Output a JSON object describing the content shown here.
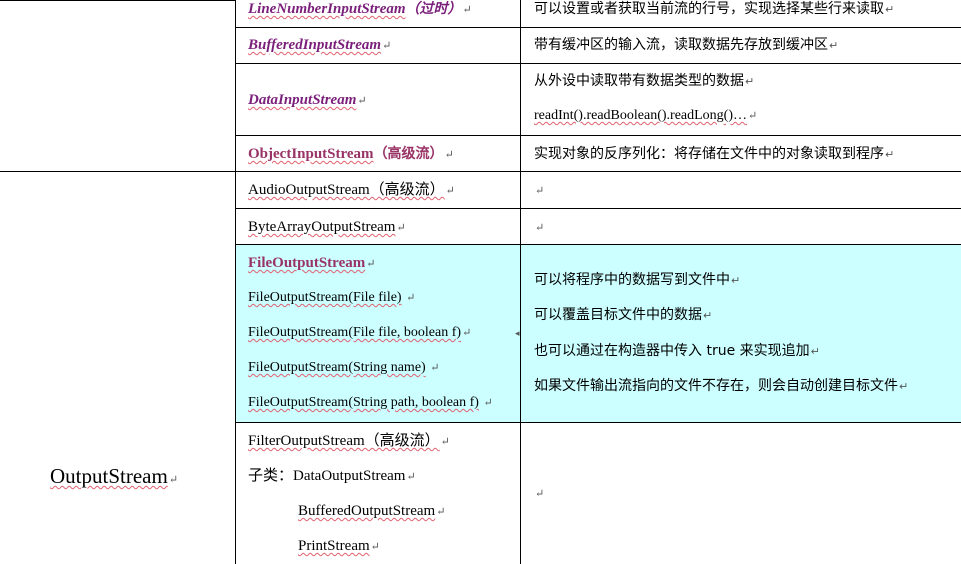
{
  "para_mark": "↵",
  "input_rows": [
    {
      "class_name": "LineNumberInputStream",
      "suffix": "（过时）",
      "desc": [
        "可以设置或者获取当前流的行号，实现选择某些行来读取"
      ]
    },
    {
      "class_name": "BufferedInputStream",
      "suffix": "",
      "desc": [
        "带有缓冲区的输入流，读取数据先存放到缓冲区"
      ]
    },
    {
      "class_name": "DataInputStream",
      "suffix": "",
      "desc": [
        "从外设中读取带有数据类型的数据",
        "readInt().readBoolean().readLong()…"
      ]
    },
    {
      "class_name": "ObjectInputStream",
      "suffix": "（高级流）",
      "desc": [
        "实现对象的反序列化：将存储在文件中的对象读取到程序"
      ]
    }
  ],
  "output_group": {
    "label": "OutputStream",
    "rows": [
      {
        "lines": [
          "AudioOutputStream（高级流）"
        ],
        "desc": []
      },
      {
        "lines": [
          "ByteArrayOutputStream"
        ],
        "desc": []
      },
      {
        "title": "FileOutputStream",
        "lines": [
          "FileOutputStream(File file)",
          "FileOutputStream(File file, boolean f)",
          "FileOutputStream(String name)",
          "FileOutputStream(String path, boolean f)"
        ],
        "desc": [
          "可以将程序中的数据写到文件中",
          "可以覆盖目标文件中的数据",
          "也可以通过在构造器中传入 true 来实现追加",
          "如果文件输出流指向的文件不存在，则会自动创建目标文件"
        ],
        "highlight": "#ccffff"
      },
      {
        "lines": [
          "FilterOutputStream（高级流）",
          "子类：DataOutputStream",
          "BufferedOutputStream",
          "PrintStream"
        ],
        "desc": []
      }
    ]
  }
}
